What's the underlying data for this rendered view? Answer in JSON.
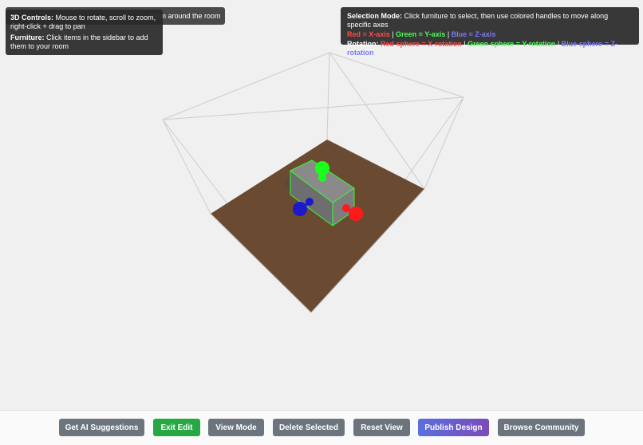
{
  "tooltips": {
    "back_text": "them around the room",
    "controls": {
      "title": "3D Controls:",
      "text": "Mouse to rotate, scroll to zoom, right-click + drag to pan"
    },
    "furniture": {
      "title": "Furniture:",
      "text": "Click items in the sidebar to add them to your room"
    },
    "selection": {
      "title": "Selection Mode:",
      "text": "Click furniture to select, then use colored handles to move along specific axes",
      "axes": {
        "red": "Red = X-axis",
        "green": "Green = Y-axis",
        "blue": "Blue = Z-axis",
        "sep": "|"
      },
      "rotation": {
        "title": "Rotation:",
        "red": "Red sphere = X-rotation",
        "green": "Green sphere = Y-rotation",
        "blue": "Blue sphere = Z-rotation",
        "sep": "|"
      }
    }
  },
  "buttons": {
    "ai_suggestions": "Get AI Suggestions",
    "exit_edit": "Exit Edit",
    "view_mode": "View Mode",
    "delete_selected": "Delete Selected",
    "reset_view": "Reset View",
    "publish_design": "Publish Design",
    "browse_community": "Browse Community"
  },
  "colors": {
    "floor": "#6b4a32",
    "wireframe": "#cccccc",
    "selection_outline": "#33ff33",
    "handle_x": "#ff1a1a",
    "handle_y": "#1aff1a",
    "handle_z": "#1a1acc",
    "button_gray": "#6c757d",
    "button_green": "#28a745"
  }
}
